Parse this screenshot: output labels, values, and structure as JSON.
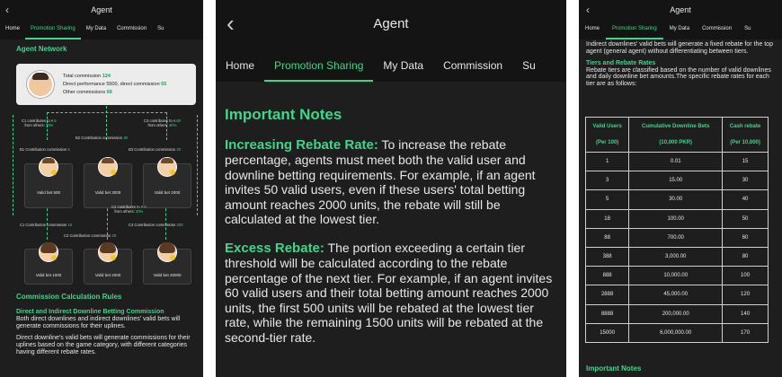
{
  "appbar": {
    "title": "Agent",
    "back_icon": "chevron-left-icon"
  },
  "tabs": [
    "Home",
    "Promotion Sharing",
    "My Data",
    "Commission",
    "Su"
  ],
  "left": {
    "network_title": "Agent Network",
    "summary": {
      "total_label": "Total commission",
      "total_value": "124",
      "direct_perf_label": "Direct performance",
      "direct_perf_value": "5500",
      "direct_comm_label": ", direct commission",
      "direct_comm_value": "55",
      "other_label": "Other commissions",
      "other_value": "69"
    },
    "annotations": {
      "c1_to_a_1": "C1 contributes to A",
      "c1_to_a_2": "from others",
      "c1_to_a_v1": "5",
      "c1_to_a_v2": "30%",
      "c3_to_a_1": "C3 contributes to A",
      "c3_to_a_2": "from others",
      "c3_to_a_v1": "60",
      "c3_to_a_v2": "30%",
      "b2_label": "B2 Contribution commission",
      "b2_value": "30",
      "b1_label": "B1 Contribution commission",
      "b1_value": "5",
      "b3_label": "B3 Contribution commission",
      "b3_value": "20",
      "c2_to_a_1": "C2 contributes to A",
      "c2_to_a_2": "from others",
      "c2_to_a_v1": "6",
      "c2_to_a_v2": "20%",
      "c1_label": "C1 Contribution commission",
      "c1_value": "10",
      "c3_label": "C3 Contribution commission",
      "c3_value": "200",
      "c2_label": "C2 Contribution commission",
      "c2_value": "20"
    },
    "b_cards": [
      "Valid bet 500",
      "Valid bet 3000",
      "Valid bet 2000"
    ],
    "c_cards": [
      "Valid bet 1000",
      "Valid bet 2000",
      "Valid bet 20000"
    ],
    "rules_title": "Commission Calculation Rules",
    "rules_sub": "Direct and Indirect Downline Betting Commission",
    "rules_p1": "Both direct downlines and indirect downlines' valid bets will generate commissions for their uplines.",
    "rules_p2": "Direct downline's valid bets will generate commissions for their uplines based on the game category, with different categories having different rebate rates."
  },
  "middle": {
    "title": "Important Notes",
    "p1_head": "Increasing Rebate Rate:",
    "p1_body": " To increase the rebate percentage, agents must meet both the valid user and downline betting requirements. For example, if an agent invites 50 valid users, even if these users' total betting amount reaches 2000 units, the rebate will still be calculated at the lowest tier.",
    "p2_head": "Excess Rebate:",
    "p2_body": " The portion exceeding a certain tier threshold will be calculated according to the rebate percentage of the next tier. For example, if an agent invites 60 valid users and their total betting amount reaches 2000 units, the first 500 units will be rebated at the lowest tier rate, while the remaining 1500 units will be rebated at the second-tier rate."
  },
  "right": {
    "intro": "Indirect downlines' valid bets will generate a fixed rebate for the top agent (general agent) without differentiating between tiers.",
    "tiers_title": "Tiers and Rebate Rates",
    "tiers_body": "Rebate tiers are classified based on the number of valid downlines and daily downline bet amounts.The specific rebate rates for each tier are as follows:",
    "headers": {
      "h1": "Valid Users",
      "h1s": "(Per 100)",
      "h2": "Cumulative Downline Bets",
      "h2s": "(10,000 PKR)",
      "h3": "Cash rebate",
      "h3s": "(Per 10,000)"
    },
    "rows": [
      [
        "1",
        "0.01",
        "15"
      ],
      [
        "3",
        "15.00",
        "30"
      ],
      [
        "5",
        "30.00",
        "40"
      ],
      [
        "18",
        "100.00",
        "50"
      ],
      [
        "88",
        "700.00",
        "60"
      ],
      [
        "388",
        "3,000.00",
        "80"
      ],
      [
        "888",
        "10,000.00",
        "100"
      ],
      [
        "2888",
        "45,000.00",
        "120"
      ],
      [
        "8888",
        "200,000.00",
        "140"
      ],
      [
        "15000",
        "6,000,000.00",
        "170"
      ]
    ],
    "footer": "Important Notes"
  }
}
